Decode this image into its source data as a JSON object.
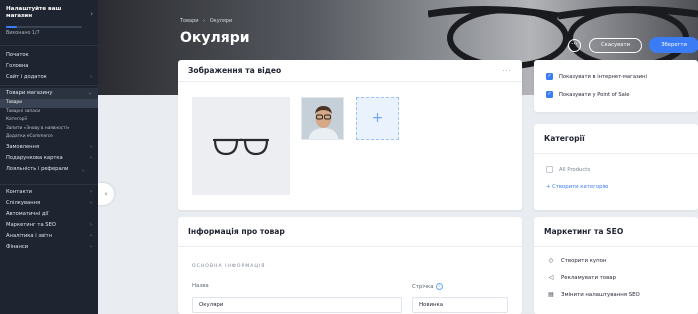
{
  "sidebar": {
    "setup_title": "Налаштуйте ваш магазин",
    "setup_progress": "Виконано 1/7",
    "setup_progress_fraction": 0.14,
    "items": [
      {
        "label": "Початок"
      },
      {
        "label": "Головна"
      },
      {
        "label": "Сайт і додаток"
      },
      {
        "label": "Товари магазину"
      }
    ],
    "sub_items": [
      {
        "label": "Товари",
        "active": true
      },
      {
        "label": "Товарні запаси"
      },
      {
        "label": "Категорії"
      },
      {
        "label": "Запити «Знову в наявності»"
      },
      {
        "label": "Додатки eCommerce"
      }
    ],
    "items_after": [
      {
        "label": "Замовлення"
      },
      {
        "label": "Подарункова картка"
      },
      {
        "label": "Лояльність і реферали"
      },
      {
        "label": "Контакти"
      },
      {
        "label": "Спілкування"
      },
      {
        "label": "Автоматичні дії"
      },
      {
        "label": "Маркетинг та SEO"
      },
      {
        "label": "Аналітика і звітн"
      },
      {
        "label": "Фінанси"
      }
    ]
  },
  "header": {
    "breadcrumb_root": "Товари",
    "breadcrumb_sep": "›",
    "breadcrumb_current": "Окуляри",
    "title": "Окуляри",
    "more_label": "···",
    "cancel_label": "Скасувати",
    "save_label": "Зберегти"
  },
  "media": {
    "title": "Зображення та відео",
    "more_label": "···",
    "add_label": "+"
  },
  "info": {
    "title": "Інформація про товар",
    "section": "ОСНОВНА ІНФОРМАЦІЯ",
    "name_label": "Назва",
    "name_value": "Окуляри",
    "ribbon_label": "Стрічка",
    "ribbon_value": "Новинка"
  },
  "channels": {
    "items": [
      {
        "label": "Показувати в інтернет-магазині",
        "checked": true
      },
      {
        "label": "Показувати у Point of Sale",
        "checked": true
      }
    ]
  },
  "categories": {
    "title": "Категорії",
    "item": "All Products",
    "create": "+ Створити категорію"
  },
  "seo": {
    "title": "Маркетинг та SEO",
    "items": [
      {
        "label": "Створити купон",
        "icon": "tag-icon"
      },
      {
        "label": "Рекламувати товар",
        "icon": "megaphone-icon"
      },
      {
        "label": "Змінити налаштування SEO",
        "icon": "document-icon"
      }
    ]
  },
  "colors": {
    "accent": "#3b7cf5",
    "sidebar_bg": "#1e2430",
    "page_bg": "#e9ecf1"
  }
}
